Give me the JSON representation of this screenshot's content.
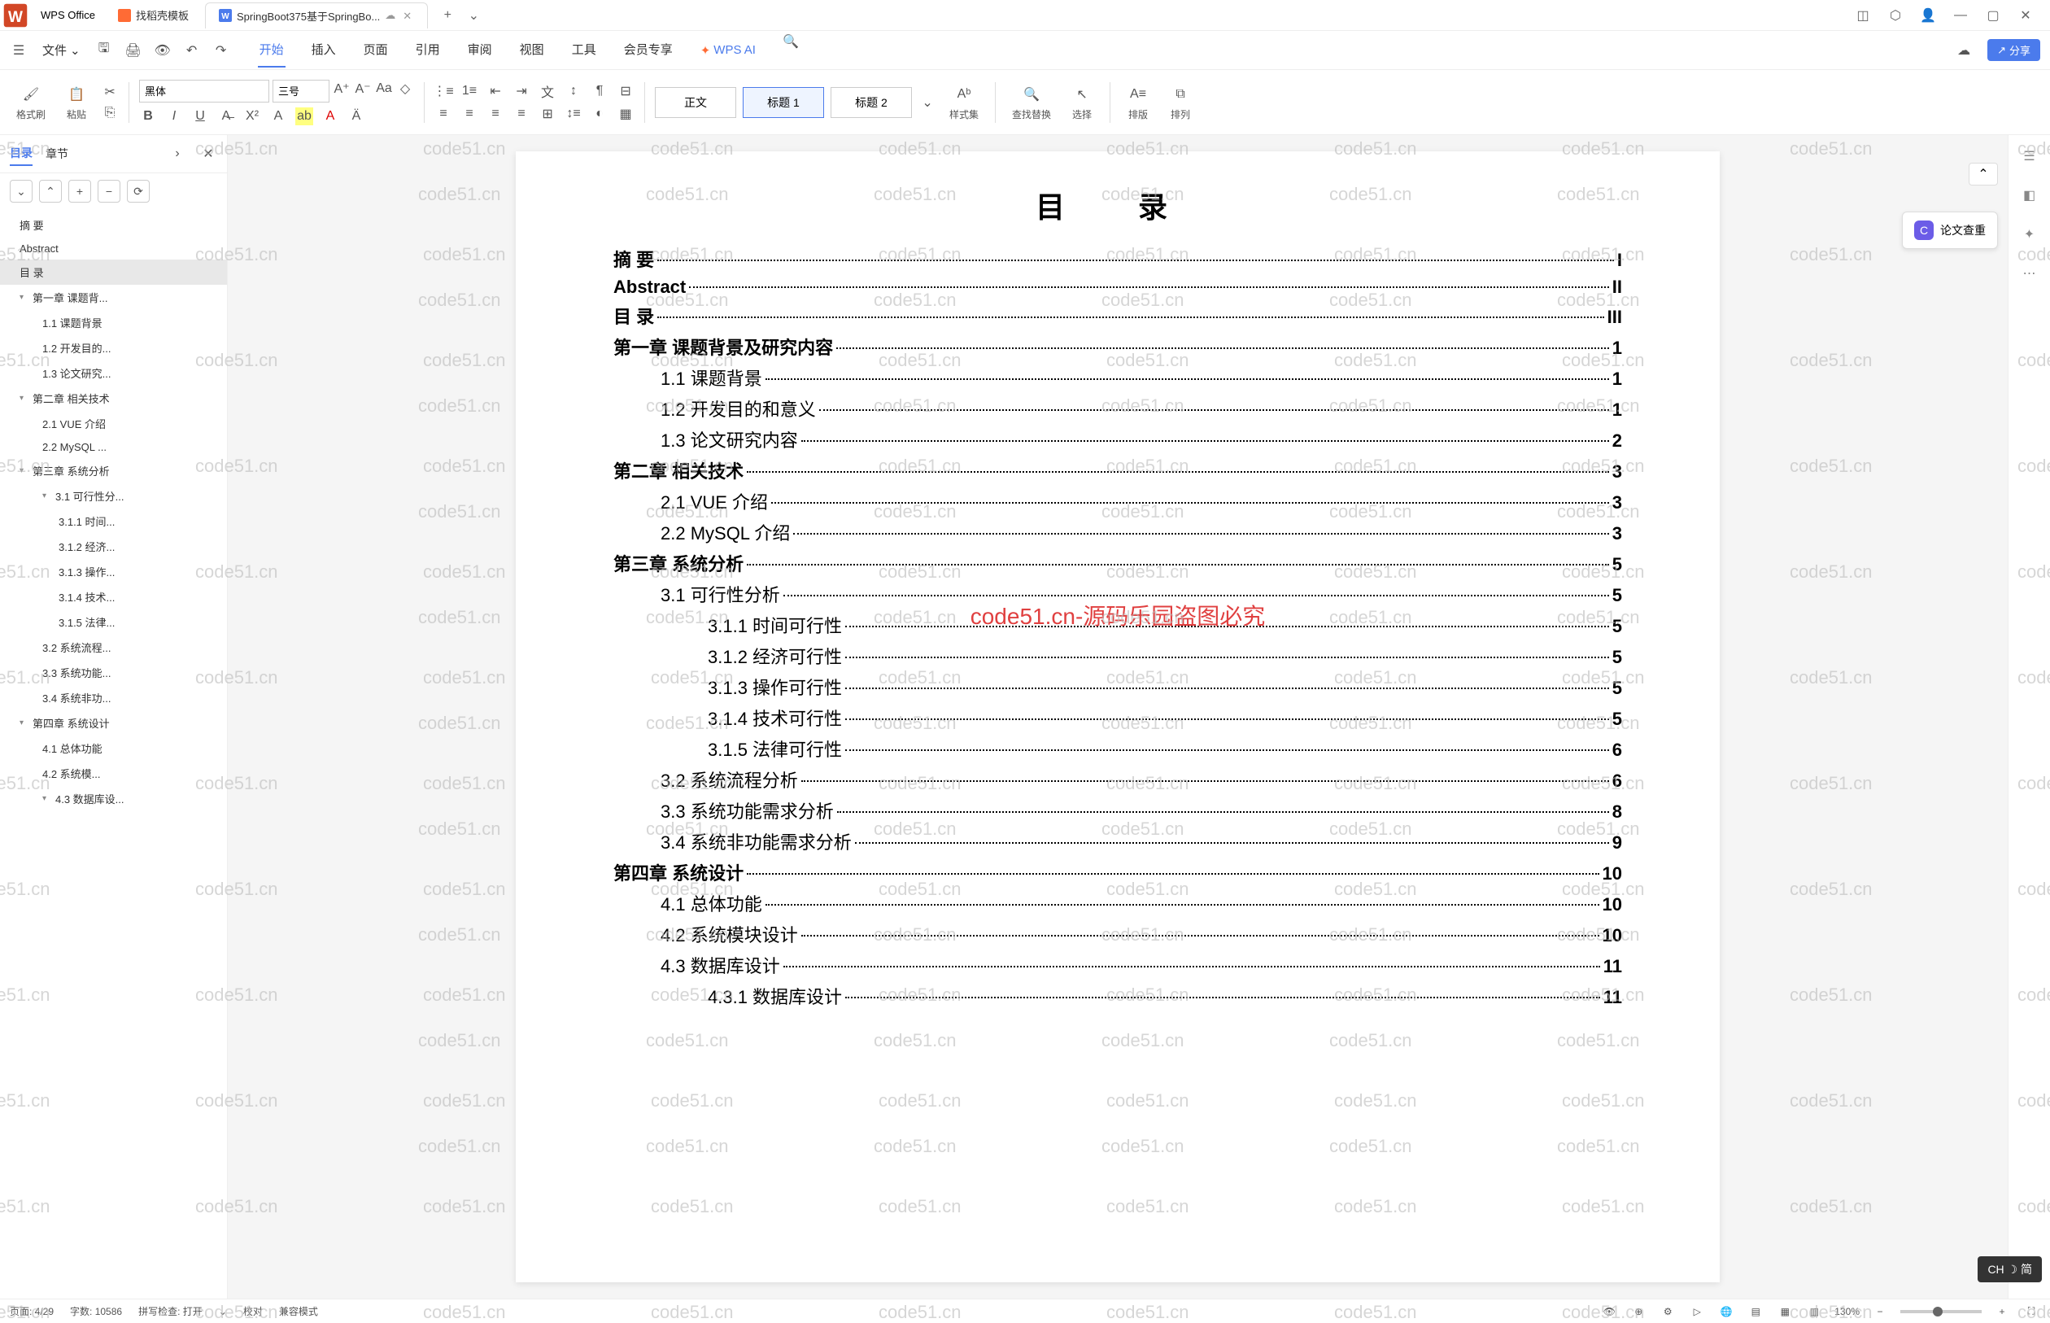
{
  "app_name": "WPS Office",
  "tabs": [
    {
      "label": "找稻壳模板",
      "icon_color": "#ff6b35"
    },
    {
      "label": "SpringBoot375基于SpringBo...",
      "icon_color": "#4b7bec",
      "active": true
    }
  ],
  "menu": {
    "file": "文件",
    "tabs": [
      "开始",
      "插入",
      "页面",
      "引用",
      "审阅",
      "视图",
      "工具",
      "会员专享"
    ],
    "active_tab": "开始",
    "wps_ai": "WPS AI",
    "share": "分享"
  },
  "ribbon": {
    "format_painter": "格式刷",
    "paste": "粘贴",
    "font_name": "黑体",
    "font_size": "三号",
    "styles": {
      "normal": "正文",
      "heading1": "标题 1",
      "heading2": "标题 2"
    },
    "style_set": "样式集",
    "find_replace": "查找替换",
    "select": "选择",
    "sort": "排版",
    "arrange": "排列"
  },
  "sidebar": {
    "tab_toc": "目录",
    "tab_chapter": "章节",
    "items": [
      {
        "label": "摘    要",
        "level": 1
      },
      {
        "label": "Abstract",
        "level": 1
      },
      {
        "label": "目    录",
        "level": 1,
        "selected": true
      },
      {
        "label": "第一章  课题背...",
        "level": 1,
        "expand": true
      },
      {
        "label": "1.1 课题背景",
        "level": 2
      },
      {
        "label": "1.2 开发目的...",
        "level": 2
      },
      {
        "label": "1.3 论文研究...",
        "level": 2
      },
      {
        "label": "第二章 相关技术",
        "level": 1,
        "expand": true
      },
      {
        "label": "2.1 VUE 介绍",
        "level": 2
      },
      {
        "label": "2.2 MySQL ...",
        "level": 2
      },
      {
        "label": "第三章 系统分析",
        "level": 1,
        "expand": true
      },
      {
        "label": "3.1 可行性分...",
        "level": 2,
        "expand": true
      },
      {
        "label": "3.1.1 时间...",
        "level": 3
      },
      {
        "label": "3.1.2 经济...",
        "level": 3
      },
      {
        "label": "3.1.3 操作...",
        "level": 3
      },
      {
        "label": "3.1.4 技术...",
        "level": 3
      },
      {
        "label": "3.1.5 法律...",
        "level": 3
      },
      {
        "label": "3.2 系统流程...",
        "level": 2
      },
      {
        "label": "3.3 系统功能...",
        "level": 2
      },
      {
        "label": "3.4 系统非功...",
        "level": 2
      },
      {
        "label": "第四章 系统设计",
        "level": 1,
        "expand": true
      },
      {
        "label": "4.1 总体功能",
        "level": 2
      },
      {
        "label": "4.2 系统模...",
        "level": 2
      },
      {
        "label": "4.3 数据库设...",
        "level": 2,
        "expand": true
      }
    ]
  },
  "document": {
    "title": "目    录",
    "toc": [
      {
        "text": "摘    要",
        "page": "I",
        "level": 1,
        "bold": true
      },
      {
        "text": "Abstract",
        "page": "II",
        "level": 1,
        "bold": true
      },
      {
        "text": "目    录",
        "page": "III",
        "level": 1,
        "bold": true
      },
      {
        "text": "第一章    课题背景及研究内容",
        "page": "1",
        "level": 1,
        "bold": true
      },
      {
        "text": "1.1 课题背景",
        "page": "1",
        "level": 2
      },
      {
        "text": "1.2 开发目的和意义",
        "page": "1",
        "level": 2
      },
      {
        "text": "1.3 论文研究内容",
        "page": "2",
        "level": 2
      },
      {
        "text": "第二章  相关技术",
        "page": "3",
        "level": 1,
        "bold": true
      },
      {
        "text": "2.1 VUE 介绍",
        "page": "3",
        "level": 2
      },
      {
        "text": "2.2 MySQL 介绍",
        "page": "3",
        "level": 2
      },
      {
        "text": "第三章  系统分析",
        "page": "5",
        "level": 1,
        "bold": true
      },
      {
        "text": "3.1 可行性分析",
        "page": "5",
        "level": 2
      },
      {
        "text": "3.1.1 时间可行性",
        "page": "5",
        "level": 3
      },
      {
        "text": "3.1.2 经济可行性",
        "page": "5",
        "level": 3
      },
      {
        "text": "3.1.3 操作可行性",
        "page": "5",
        "level": 3
      },
      {
        "text": "3.1.4 技术可行性",
        "page": "5",
        "level": 3
      },
      {
        "text": "3.1.5 法律可行性",
        "page": "6",
        "level": 3
      },
      {
        "text": "3.2 系统流程分析",
        "page": "6",
        "level": 2
      },
      {
        "text": "3.3 系统功能需求分析",
        "page": "8",
        "level": 2
      },
      {
        "text": "3.4  系统非功能需求分析",
        "page": "9",
        "level": 2
      },
      {
        "text": "第四章  系统设计",
        "page": "10",
        "level": 1,
        "bold": true
      },
      {
        "text": "4.1  总体功能",
        "page": "10",
        "level": 2
      },
      {
        "text": "4.2  系统模块设计",
        "page": "10",
        "level": 2
      },
      {
        "text": "4.3  数据库设计",
        "page": "11",
        "level": 2
      },
      {
        "text": "4.3.1  数据库设计",
        "page": "11",
        "level": 3
      }
    ],
    "watermark_text": "code51.cn",
    "watermark_red": "code51.cn-源码乐园盗图必究"
  },
  "float_button": "论文查重",
  "status": {
    "page": "页面: 4/29",
    "words": "字数: 10586",
    "spell": "拼写检查: 打开",
    "proof": "校对",
    "compat": "兼容模式",
    "zoom": "130%"
  },
  "ime": "CH ☽ 简"
}
